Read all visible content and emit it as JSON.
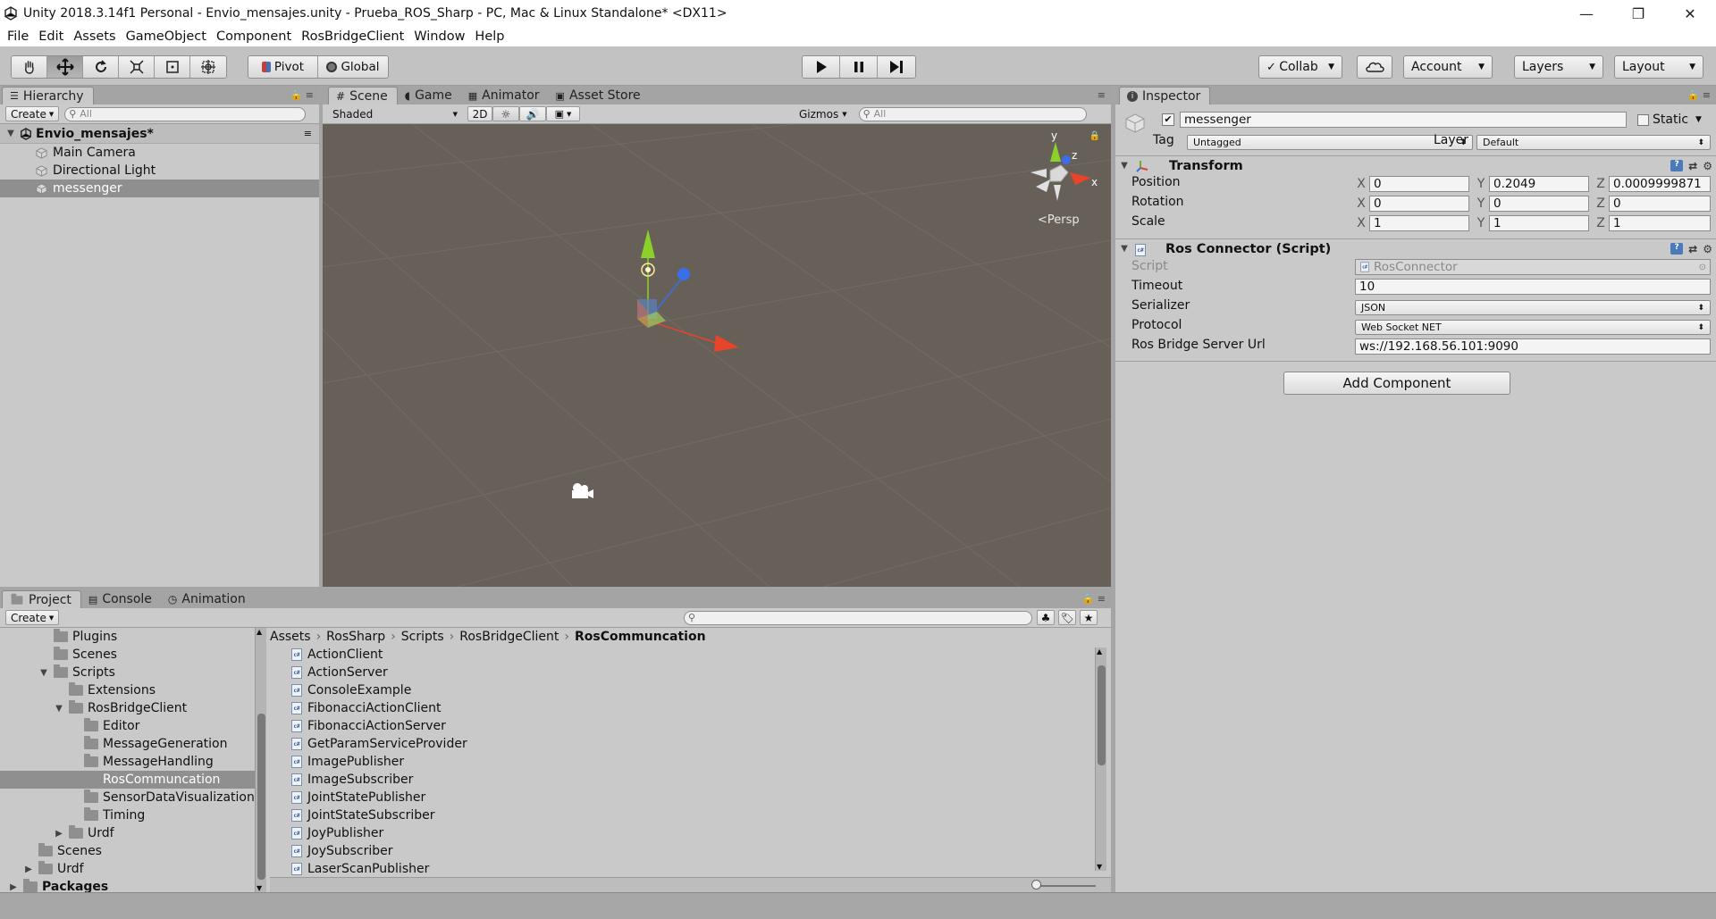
{
  "window": {
    "title": "Unity 2018.3.14f1 Personal - Envio_mensajes.unity - Prueba_ROS_Sharp - PC, Mac & Linux Standalone* <DX11>",
    "minimize": "—",
    "maximize": "❐",
    "close": "✕"
  },
  "menu": [
    "File",
    "Edit",
    "Assets",
    "GameObject",
    "Component",
    "RosBridgeClient",
    "Window",
    "Help"
  ],
  "toolbar": {
    "pivot_label": "Pivot",
    "global_label": "Global",
    "collab_label": "Collab",
    "account_label": "Account",
    "layers_label": "Layers",
    "layout_label": "Layout"
  },
  "hierarchy": {
    "tab": "Hierarchy",
    "create": "Create",
    "search_placeholder": "All",
    "scene_name": "Envio_mensajes*",
    "items": [
      "Main Camera",
      "Directional Light",
      "messenger"
    ]
  },
  "scene": {
    "tabs": [
      "Scene",
      "Game",
      "Animator",
      "Asset Store"
    ],
    "shading": "Shaded",
    "mode_2d": "2D",
    "gizmos": "Gizmos",
    "search_placeholder": "All",
    "persp_label": "Persp",
    "axis_y": "y",
    "axis_x": "x",
    "axis_z": "z"
  },
  "inspector": {
    "tab": "Inspector",
    "object_name": "messenger",
    "static_label": "Static",
    "tag_label": "Tag",
    "tag_value": "Untagged",
    "layer_label": "Layer",
    "layer_value": "Default",
    "transform": {
      "title": "Transform",
      "position_label": "Position",
      "rotation_label": "Rotation",
      "scale_label": "Scale",
      "position": {
        "x": "0",
        "y": "0.2049",
        "z": "0.0009999871"
      },
      "rotation": {
        "x": "0",
        "y": "0",
        "z": "0"
      },
      "scale": {
        "x": "1",
        "y": "1",
        "z": "1"
      }
    },
    "ros_connector": {
      "title": "Ros Connector (Script)",
      "script_label": "Script",
      "script_value": "RosConnector",
      "timeout_label": "Timeout",
      "timeout_value": "10",
      "serializer_label": "Serializer",
      "serializer_value": "JSON",
      "protocol_label": "Protocol",
      "protocol_value": "Web Socket NET",
      "url_label": "Ros Bridge Server Url",
      "url_value": "ws://192.168.56.101:9090"
    },
    "add_component": "Add Component"
  },
  "project": {
    "tabs": [
      "Project",
      "Console",
      "Animation"
    ],
    "create": "Create",
    "breadcrumb": [
      "Assets",
      "RosSharp",
      "Scripts",
      "RosBridgeClient",
      "RosCommuncation"
    ],
    "tree": [
      {
        "label": "Plugins",
        "depth": 3,
        "arrow": ""
      },
      {
        "label": "Scenes",
        "depth": 3,
        "arrow": ""
      },
      {
        "label": "Scripts",
        "depth": 3,
        "arrow": "▼"
      },
      {
        "label": "Extensions",
        "depth": 4,
        "arrow": ""
      },
      {
        "label": "RosBridgeClient",
        "depth": 4,
        "arrow": "▼"
      },
      {
        "label": "Editor",
        "depth": 5,
        "arrow": ""
      },
      {
        "label": "MessageGeneration",
        "depth": 5,
        "arrow": ""
      },
      {
        "label": "MessageHandling",
        "depth": 5,
        "arrow": ""
      },
      {
        "label": "RosCommuncation",
        "depth": 5,
        "arrow": "",
        "selected": true
      },
      {
        "label": "SensorDataVisualization",
        "depth": 5,
        "arrow": ""
      },
      {
        "label": "Timing",
        "depth": 5,
        "arrow": ""
      },
      {
        "label": "Urdf",
        "depth": 4,
        "arrow": "▶"
      },
      {
        "label": "Scenes",
        "depth": 2,
        "arrow": ""
      },
      {
        "label": "Urdf",
        "depth": 2,
        "arrow": "▶"
      },
      {
        "label": "Packages",
        "depth": 1,
        "arrow": "▶",
        "bold": true
      }
    ],
    "files": [
      "ActionClient",
      "ActionServer",
      "ConsoleExample",
      "FibonacciActionClient",
      "FibonacciActionServer",
      "GetParamServiceProvider",
      "ImagePublisher",
      "ImageSubscriber",
      "JointStatePublisher",
      "JointStateSubscriber",
      "JoyPublisher",
      "JoySubscriber",
      "LaserScanPublisher"
    ],
    "file_icon": "c#"
  },
  "colors": {
    "scene_bg": "#676058",
    "selection": "#8f8f8f",
    "axis_x": "#e8442a",
    "axis_y": "#8bd12a",
    "axis_z": "#3a6fe8"
  }
}
